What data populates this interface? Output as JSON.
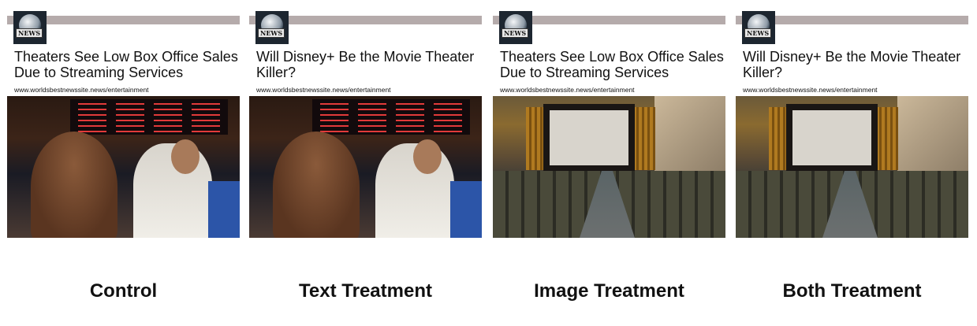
{
  "logo_text": "NEWS",
  "url": "www.worldsbestnewssite.news/entertainment",
  "cards": [
    {
      "headline": "Theaters See Low Box Office Sales Due to Streaming Services",
      "image": "movie-theater-lobby",
      "label": "Control"
    },
    {
      "headline": "Will Disney+ Be the Movie Theater Killer?",
      "image": "movie-theater-lobby",
      "label": "Text Treatment"
    },
    {
      "headline": "Theaters See Low Box Office Sales Due to Streaming Services",
      "image": "abandoned-theater",
      "label": "Image Treatment"
    },
    {
      "headline": "Will Disney+ Be the Movie Theater Killer?",
      "image": "abandoned-theater",
      "label": "Both Treatment"
    }
  ]
}
